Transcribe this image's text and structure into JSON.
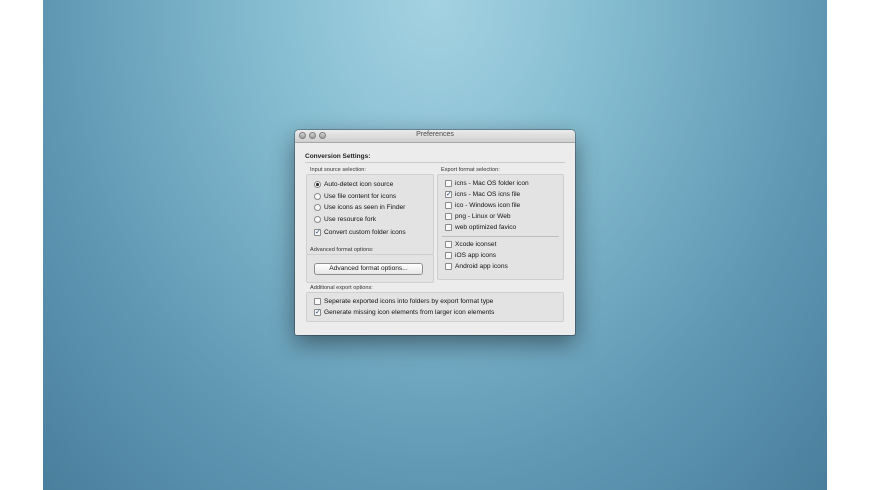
{
  "window": {
    "title": "Preferences"
  },
  "conversion_settings_label": "Conversion Settings:",
  "input_source": {
    "label": "Input source selection:",
    "options": [
      {
        "label": "Auto-detect icon source",
        "selected": true
      },
      {
        "label": "Use file content for icons",
        "selected": false
      },
      {
        "label": "Use icons as seen in Finder",
        "selected": false
      },
      {
        "label": "Use resource fork",
        "selected": false
      }
    ],
    "convert_custom": {
      "label": "Convert custom folder icons",
      "checked": true
    }
  },
  "export_format": {
    "label": "Export format selection:",
    "items": [
      {
        "label": "icns - Mac OS folder icon",
        "checked": false
      },
      {
        "label": "icns - Mac OS icns file",
        "checked": true
      },
      {
        "label": "ico  - Windows icon file",
        "checked": false
      },
      {
        "label": "png  - Linux or Web",
        "checked": false
      },
      {
        "label": "web optimized favico",
        "checked": false
      }
    ],
    "extra_items": [
      {
        "label": "Xcode iconset",
        "checked": false
      },
      {
        "label": "iOS app icons",
        "checked": false
      },
      {
        "label": "Android app icons",
        "checked": false
      }
    ]
  },
  "advanced": {
    "label": "Advanced format options:",
    "button_label": "Advanced format options..."
  },
  "additional": {
    "label": "Additional export options:",
    "items": [
      {
        "label": "Seperate exported icons into folders by export format type",
        "checked": false
      },
      {
        "label": "Generate missing icon elements from larger icon elements",
        "checked": true
      }
    ]
  }
}
